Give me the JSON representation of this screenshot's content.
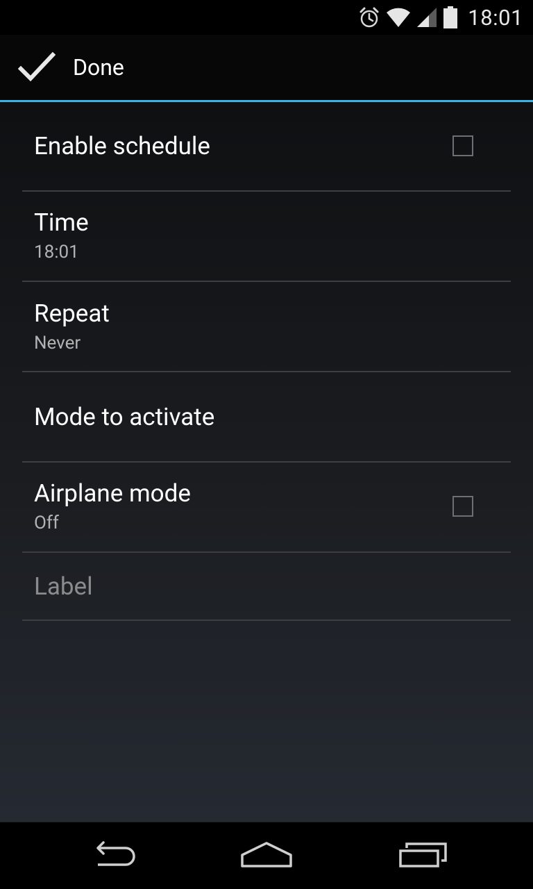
{
  "status_bar": {
    "time": "18:01",
    "icons": [
      "alarm-icon",
      "wifi-icon",
      "signal-icon",
      "battery-icon"
    ]
  },
  "action_bar": {
    "done_label": "Done",
    "done_icon": "checkmark-icon",
    "accent_color": "#33b5e5"
  },
  "preferences": [
    {
      "title": "Enable schedule",
      "summary": "",
      "checkbox": true,
      "checked": false
    },
    {
      "title": "Time",
      "summary": "18:01",
      "checkbox": false
    },
    {
      "title": "Repeat",
      "summary": "Never",
      "checkbox": false
    },
    {
      "title": "Mode to activate",
      "summary": "",
      "checkbox": false
    },
    {
      "title": "Airplane mode",
      "summary": "Off",
      "checkbox": true,
      "checked": false
    }
  ],
  "label_field": {
    "placeholder": "Label",
    "value": ""
  },
  "nav_bar": {
    "buttons": [
      "back-icon",
      "home-icon",
      "recents-icon"
    ]
  }
}
